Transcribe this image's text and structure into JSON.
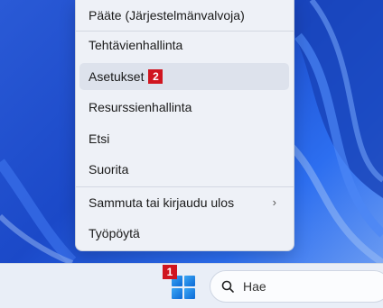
{
  "menu": {
    "items": [
      {
        "label": "Pääte (Järjestelmänvalvoja)"
      },
      {
        "label": "Tehtävienhallinta"
      },
      {
        "label": "Asetukset",
        "badge": "2"
      },
      {
        "label": "Resurssienhallinta"
      },
      {
        "label": "Etsi"
      },
      {
        "label": "Suorita"
      },
      {
        "label": "Sammuta tai kirjaudu ulos",
        "chevron": "›"
      },
      {
        "label": "Työpöytä"
      }
    ]
  },
  "taskbar": {
    "start_badge": "1",
    "search_placeholder": "Hae"
  },
  "colors": {
    "badge": "#d0151f",
    "accent": "#0c6ad6"
  }
}
